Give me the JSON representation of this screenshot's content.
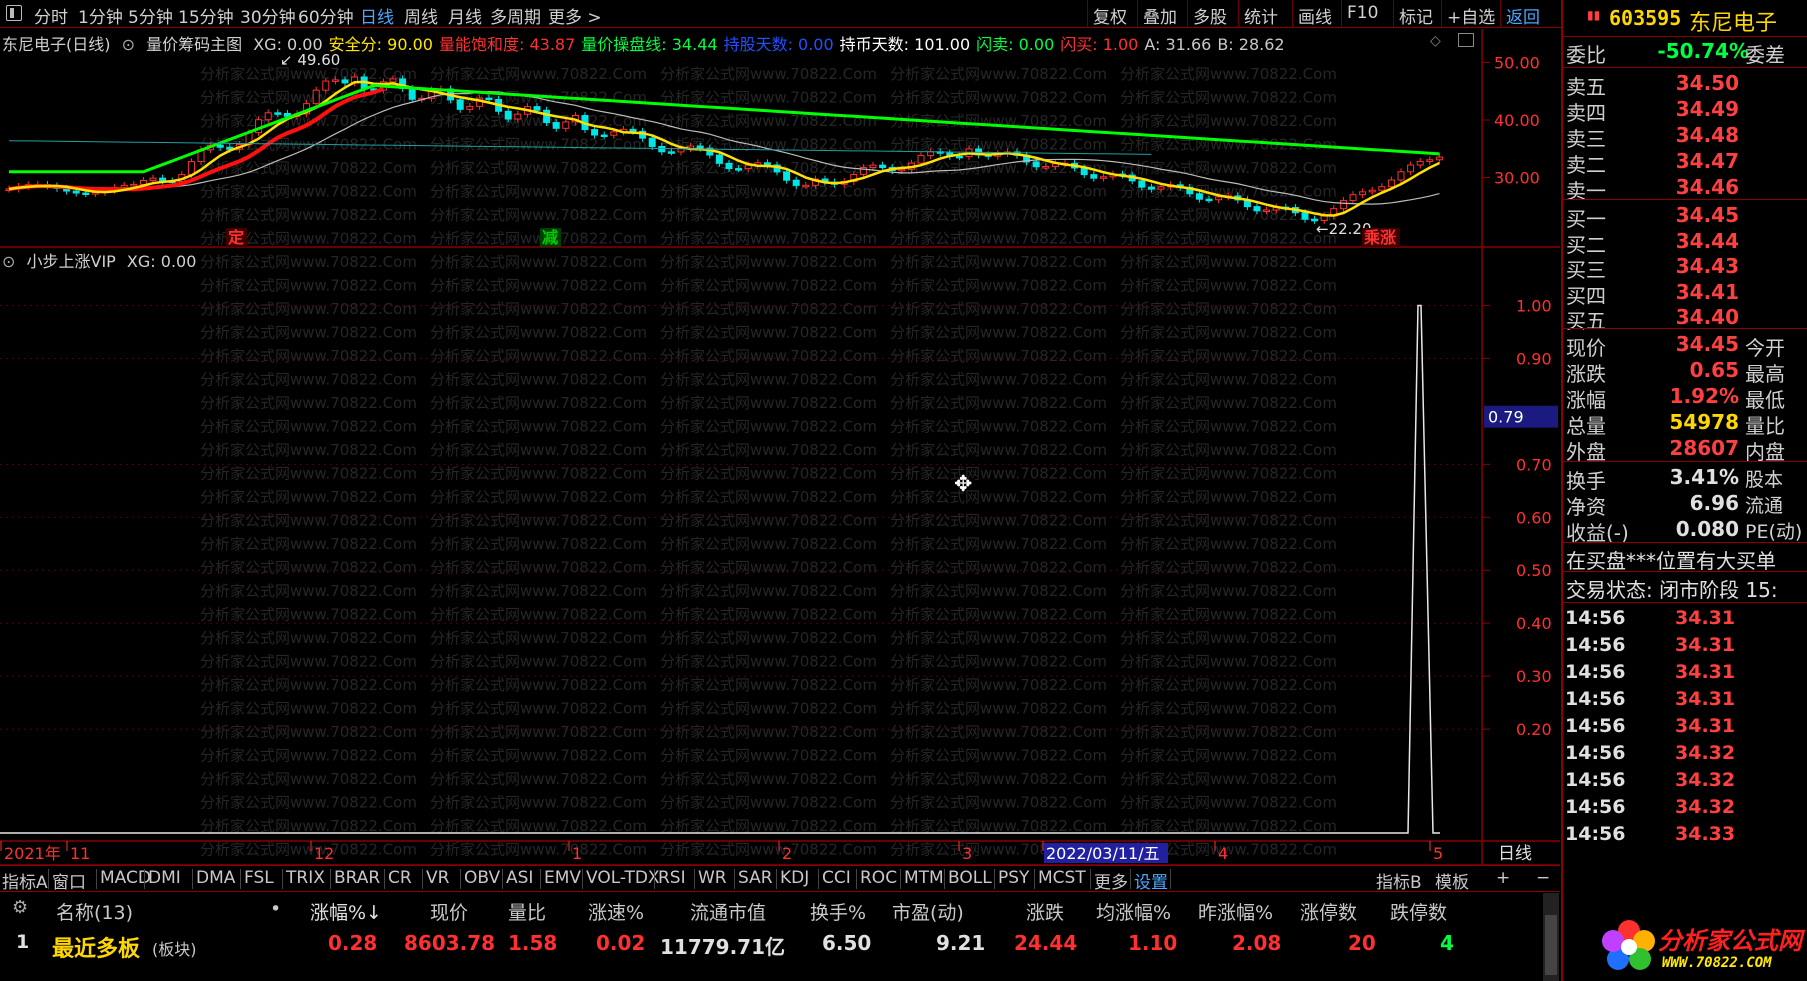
{
  "toolbar": {
    "periods": [
      "分时",
      "1分钟",
      "5分钟",
      "15分钟",
      "30分钟",
      "60分钟",
      "日线",
      "周线",
      "月线",
      "多周期",
      "更多 >"
    ],
    "active_period": "日线",
    "actions": [
      "复权",
      "叠加",
      "多股",
      "统计",
      "画线",
      "F10",
      "标记",
      "+自选",
      "返回"
    ]
  },
  "main_chart": {
    "title": "东尼电子(日线)",
    "indicator": "量价筹码主图",
    "legend": [
      {
        "label": "XG: 0.00",
        "color": "#d0d0d0"
      },
      {
        "label": "安全分: 90.00",
        "color": "#ffe500"
      },
      {
        "label": "量能饱和度: 43.87",
        "color": "#ff3030"
      },
      {
        "label": "量价操盘线: 34.44",
        "color": "#00ff40"
      },
      {
        "label": "持股天数: 0.00",
        "color": "#2050ff"
      },
      {
        "label": "持币天数: 101.00",
        "color": "#ffffff"
      },
      {
        "label": "闪卖: 0.00",
        "color": "#00ff40"
      },
      {
        "label": "闪买: 1.00",
        "color": "#ff3030"
      },
      {
        "label": "A: 31.66",
        "color": "#c8c8c8"
      },
      {
        "label": "B: 28.62",
        "color": "#c8c8c8"
      }
    ],
    "y_ticks": [
      "50.00",
      "40.00",
      "30.00"
    ],
    "y_range": [
      20,
      52
    ],
    "high_annotation": "49.60",
    "low_annotation": "22.20",
    "signal_labels": [
      {
        "text": "定",
        "color": "#ff3030"
      },
      {
        "text": "减",
        "color": "#00cc00"
      },
      {
        "text": "乘涨",
        "color": "#ff3030"
      }
    ]
  },
  "sub_chart": {
    "indicator": "小步上涨VIP",
    "legend": "XG: 0.00",
    "y_ticks": [
      "1.00",
      "0.90",
      "0.79",
      "0.70",
      "0.60",
      "0.50",
      "0.40",
      "0.30",
      "0.20"
    ],
    "current_value": "0.79"
  },
  "watermark": "分析家公式网www.70822.Com",
  "x_axis": {
    "labels": [
      "2021年",
      "11",
      "12",
      "1",
      "2",
      "3",
      "2022/03/11/五",
      "4",
      "5"
    ],
    "period_label": "日线"
  },
  "indicator_tabs": [
    "指标A",
    "窗口",
    "MACD",
    "DMI",
    "DMA",
    "FSL",
    "TRIX",
    "BRAR",
    "CR",
    "VR",
    "OBV",
    "ASI",
    "EMV",
    "VOL-TDX",
    "RSI",
    "WR",
    "SAR",
    "KDJ",
    "CCI",
    "ROC",
    "MTM",
    "BOLL",
    "PSY",
    "MCST",
    "更多",
    "设置"
  ],
  "right_tabs": [
    "指标B",
    "模板",
    "+",
    "−"
  ],
  "table": {
    "headers": [
      "名称(13)",
      "•",
      "涨幅%↓",
      "现价",
      "量比",
      "涨速%",
      "流通市值",
      "换手%",
      "市盈(动)",
      "涨跌",
      "均涨幅%",
      "昨涨幅%",
      "涨停数",
      "跌停数"
    ],
    "rows": [
      {
        "idx": "1",
        "name": "最近多板",
        "tag": "(板块)",
        "chg": "0.28",
        "price": "8603.78",
        "vr": "1.58",
        "speed": "0.02",
        "mcap": "11779.71亿",
        "turn": "6.50",
        "pe": "9.21",
        "diff": "24.44",
        "avg": "1.10",
        "yest": "2.08",
        "up": "20",
        "down": "4"
      }
    ]
  },
  "quote": {
    "code": "603595",
    "name": "东尼电子",
    "ratio_label": "委比",
    "ratio_value": "-50.74%",
    "ratio_label2": "委差",
    "asks": [
      {
        "label": "卖五",
        "price": "34.50"
      },
      {
        "label": "卖四",
        "price": "34.49"
      },
      {
        "label": "卖三",
        "price": "34.48"
      },
      {
        "label": "卖二",
        "price": "34.47"
      },
      {
        "label": "卖一",
        "price": "34.46"
      }
    ],
    "bids": [
      {
        "label": "买一",
        "price": "34.45"
      },
      {
        "label": "买二",
        "price": "34.44"
      },
      {
        "label": "买三",
        "price": "34.43"
      },
      {
        "label": "买四",
        "price": "34.41"
      },
      {
        "label": "买五",
        "price": "34.40"
      }
    ],
    "stats": [
      {
        "label": "现价",
        "value": "34.45",
        "label2": "今开",
        "color": "#ff4040"
      },
      {
        "label": "涨跌",
        "value": "0.65",
        "label2": "最高",
        "color": "#ff4040"
      },
      {
        "label": "涨幅",
        "value": "1.92%",
        "label2": "最低",
        "color": "#ff4040"
      },
      {
        "label": "总量",
        "value": "54978",
        "label2": "量比",
        "color": "#ffd700"
      },
      {
        "label": "外盘",
        "value": "28607",
        "label2": "内盘",
        "color": "#ff4040"
      }
    ],
    "stats2": [
      {
        "label": "换手",
        "value": "3.41%",
        "label2": "股本",
        "color": "#e0e0e0"
      },
      {
        "label": "净资",
        "value": "6.96",
        "label2": "流通",
        "color": "#e0e0e0"
      },
      {
        "label": "收益(-)",
        "value": "0.080",
        "label2": "PE(动)",
        "color": "#e0e0e0"
      }
    ],
    "note": "在买盘***位置有大买单",
    "status": "交易状态: 闭市阶段 15:",
    "ticks": [
      {
        "time": "14:56",
        "price": "34.31"
      },
      {
        "time": "14:56",
        "price": "34.31"
      },
      {
        "time": "14:56",
        "price": "34.31"
      },
      {
        "time": "14:56",
        "price": "34.31"
      },
      {
        "time": "14:56",
        "price": "34.31"
      },
      {
        "time": "14:56",
        "price": "34.32"
      },
      {
        "time": "14:56",
        "price": "34.32"
      },
      {
        "time": "14:56",
        "price": "34.32"
      },
      {
        "time": "14:56",
        "price": "34.33"
      }
    ]
  },
  "logo": {
    "text": "分析家公式网",
    "url": "WWW.70822.COM"
  }
}
